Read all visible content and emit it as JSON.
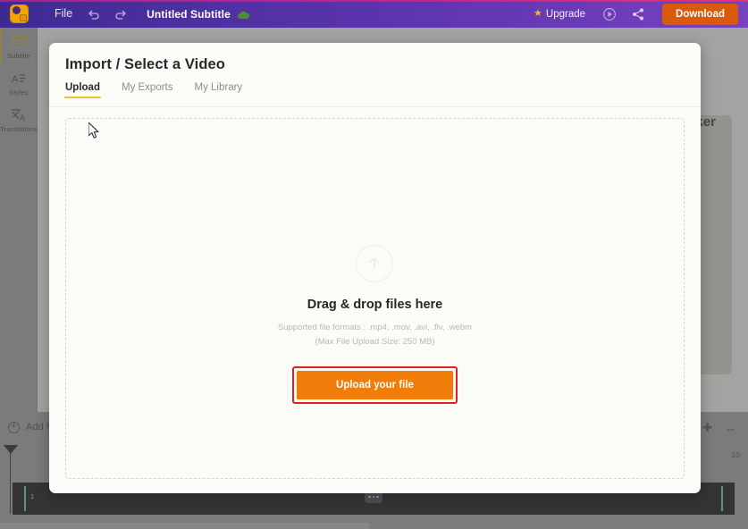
{
  "topbar": {
    "logo_icon": "app-logo-icon",
    "file_menu": "File",
    "undo_icon": "undo-icon",
    "redo_icon": "redo-icon",
    "doc_title": "Untitled Subtitle",
    "save_state_icon": "cloud-saved-icon",
    "upgrade": "Upgrade",
    "upgrade_star_icon": "star-icon",
    "preview_icon": "play-preview-icon",
    "share_icon": "share-icon",
    "download": "Download",
    "download_color": "#d95a0a"
  },
  "sidebar": {
    "items": [
      {
        "label": "Subtitle",
        "icon": "cc-icon",
        "badge": "CC",
        "active": true
      },
      {
        "label": "Styles",
        "icon": "text-styles-icon",
        "glyph": "A≡",
        "active": false
      },
      {
        "label": "Translations",
        "icon": "translate-icon",
        "glyph": "文A",
        "active": false
      }
    ]
  },
  "background": {
    "card_title_fragment": "ker"
  },
  "modal": {
    "title": "Import / Select a Video",
    "tabs": [
      {
        "label": "Upload",
        "active": true
      },
      {
        "label": "My Exports",
        "active": false
      },
      {
        "label": "My Library",
        "active": false
      }
    ],
    "dropzone": {
      "upload_icon": "upload-arrow-icon",
      "title": "Drag & drop files here",
      "formats": "Supported file formats : .mp4, .mov, .avi, .flv, .webm",
      "max_size": "(Max File Upload Size: 250 MB)",
      "button_label": "Upload your file",
      "button_color": "#f07c0a",
      "highlight_color": "#e32020"
    },
    "active_tab_color": "#f0c12b"
  },
  "toolbar": {
    "add_media": "Add M",
    "add_icon": "plus-circle-icon",
    "zoom_out_icon": "minus-icon",
    "zoom_in_icon": "plus-icon",
    "fit_icon": "fit-to-screen-icon"
  },
  "timeline": {
    "ruler_mark": "10",
    "clip_index": "1",
    "clip_menu_icon": "more-options-icon",
    "playhead_icon": "playhead-marker-icon",
    "clip_handle_color": "#4fd6b0"
  },
  "cursor": {
    "icon": "mouse-pointer-icon"
  }
}
